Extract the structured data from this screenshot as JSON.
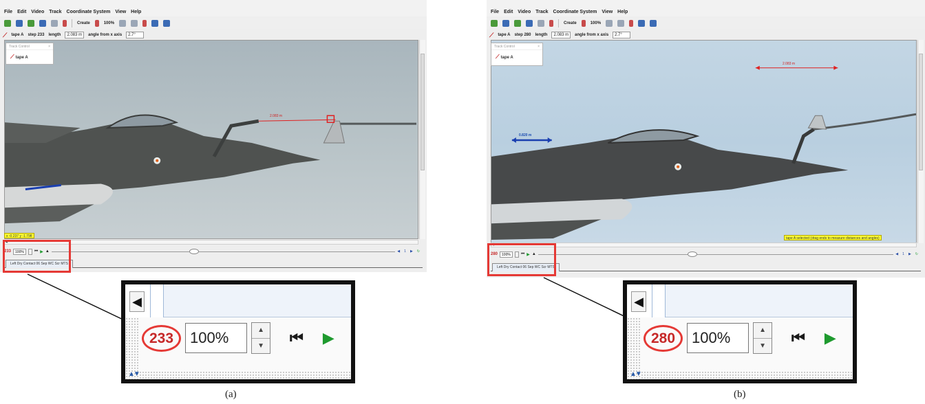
{
  "panel_a": {
    "menu": [
      "File",
      "Edit",
      "Video",
      "Track",
      "Coordinate System",
      "View",
      "Help"
    ],
    "toolbar": {
      "create_label": "Create",
      "zoom_label": "100%"
    },
    "trackbar": {
      "tape_label": "tape A",
      "step_label": "step 233",
      "length_label": "length",
      "length_value": "2.083 m",
      "angle_label": "angle from x axis",
      "angle_value": "2.7°"
    },
    "track_control": {
      "title": "Track Control",
      "item": "tape A"
    },
    "measurement_red": "2.083 m",
    "status": "x -0.237 y -1.798",
    "playback": {
      "frame": "233",
      "zoom": "100%",
      "right_counter": "1"
    },
    "tab_label": "Left Dry Contact 06 Sep WC Scr MTS"
  },
  "panel_b": {
    "menu": [
      "File",
      "Edit",
      "Video",
      "Track",
      "Coordinate System",
      "View",
      "Help"
    ],
    "toolbar": {
      "create_label": "Create",
      "zoom_label": "100%"
    },
    "trackbar": {
      "tape_label": "tape A",
      "step_label": "step 280",
      "length_label": "length",
      "length_value": "2.083 m",
      "angle_label": "angle from x axis",
      "angle_value": "2.7°"
    },
    "track_control": {
      "title": "Track Control",
      "item": "tape A"
    },
    "measurement_red": "2.083 m",
    "measurement_blue": "0.820 m",
    "status": "tape A selected (drag ends to measure distances and angles)",
    "playback": {
      "frame": "280",
      "zoom": "100%",
      "right_counter": "1"
    },
    "tab_label": "Left Dry Contact 06 Sep WC Scr MTS"
  },
  "zoom_a": {
    "frame": "233",
    "zoom": "100%"
  },
  "zoom_b": {
    "frame": "280",
    "zoom": "100%"
  },
  "captions": {
    "a": "(a)",
    "b": "(b)"
  },
  "colors": {
    "frame_red": "#c62828",
    "highlight_red": "#e53935",
    "play_green": "#1e9a2e"
  },
  "icons": [
    "tape-icon",
    "play-icon",
    "step-back-icon",
    "spinner-up-icon",
    "spinner-down-icon",
    "scroll-left-icon"
  ]
}
